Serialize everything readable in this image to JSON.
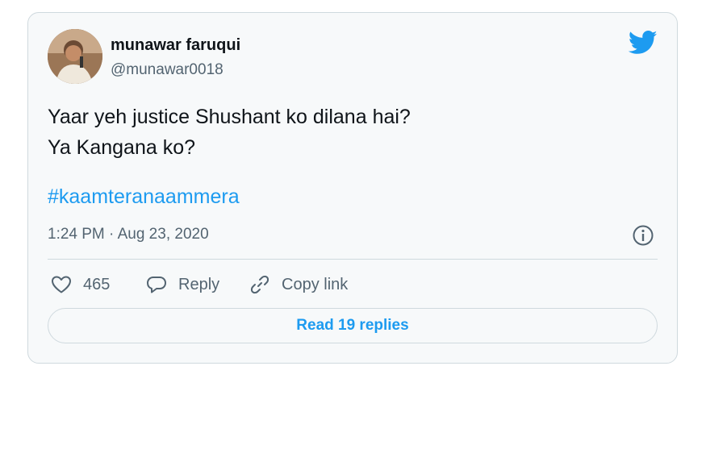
{
  "tweet": {
    "author_name": "munawar faruqui",
    "author_handle": "@munawar0018",
    "text_line1": "Yaar yeh justice Shushant ko dilana hai?",
    "text_line2": "Ya Kangana ko?",
    "hashtag": "#kaamteranaammera",
    "timestamp": "1:24 PM · Aug 23, 2020",
    "likes": "465",
    "reply_label": "Reply",
    "copy_link_label": "Copy link",
    "read_replies_label": "Read 19 replies"
  },
  "icons": {
    "brand": "twitter-bird-icon",
    "info": "info-icon",
    "like": "heart-icon",
    "reply": "speech-bubble-icon",
    "copy": "link-icon"
  },
  "colors": {
    "accent": "#1d9bf0",
    "text": "#0f1419",
    "secondary": "#536471",
    "border": "#cfd9de",
    "card_bg": "#f7f9fa"
  }
}
